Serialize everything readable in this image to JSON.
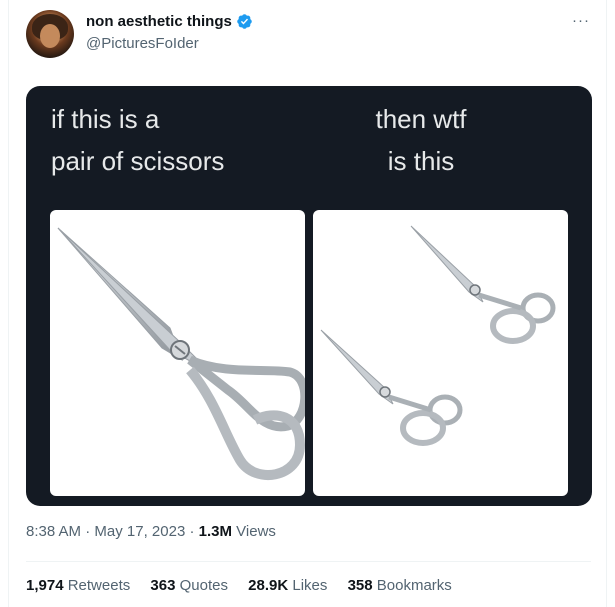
{
  "author": {
    "name": "non aesthetic things",
    "handle": "@PicturesFoIder",
    "verified": true,
    "verified_color": "#1d9bf0"
  },
  "more_icon": "more-dots-icon",
  "media": {
    "caption_left_line1": "if this is a",
    "caption_left_line2": "pair of scissors",
    "caption_right_line1": "then wtf",
    "caption_right_line2": "is this",
    "background_color": "#141a23"
  },
  "timestamp": {
    "time": "8:38 AM",
    "date": "May 17, 2023",
    "views_count": "1.3M",
    "views_label": "Views"
  },
  "stats": [
    {
      "count": "1,974",
      "label": "Retweets"
    },
    {
      "count": "363",
      "label": "Quotes"
    },
    {
      "count": "28.9K",
      "label": "Likes"
    },
    {
      "count": "358",
      "label": "Bookmarks"
    }
  ]
}
